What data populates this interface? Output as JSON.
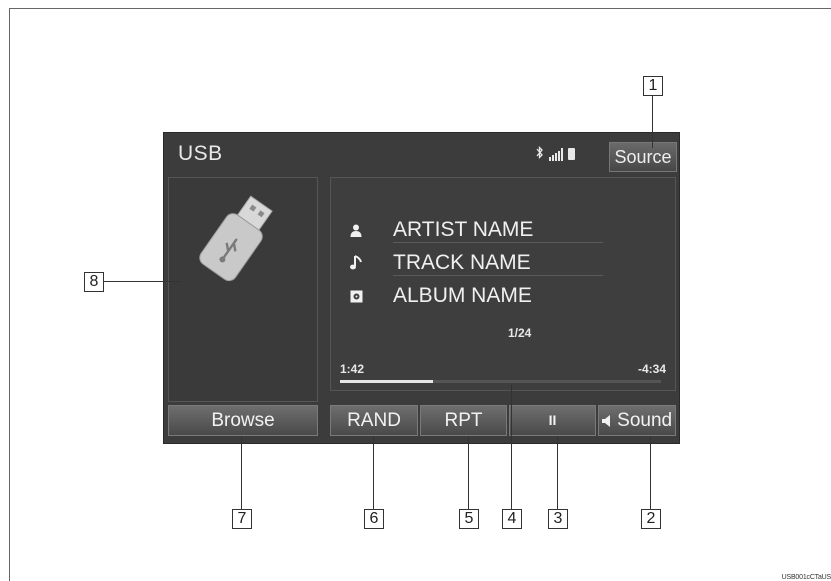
{
  "header": {
    "title": "USB",
    "source_label": "Source"
  },
  "status_icons": [
    "bluetooth-icon",
    "signal-icon",
    "battery-icon"
  ],
  "track": {
    "artist": "ARTIST NAME",
    "title": "TRACK NAME",
    "album": "ALBUM NAME",
    "count": "1/24",
    "elapsed": "1:42",
    "remaining": "-4:34",
    "progress": 0.29
  },
  "buttons": {
    "browse": "Browse",
    "rand": "RAND",
    "rpt": "RPT",
    "pause": "II",
    "sound": "Sound"
  },
  "callouts": [
    "1",
    "2",
    "3",
    "4",
    "5",
    "6",
    "7",
    "8"
  ],
  "footer_code": "USB001cCTaUS"
}
